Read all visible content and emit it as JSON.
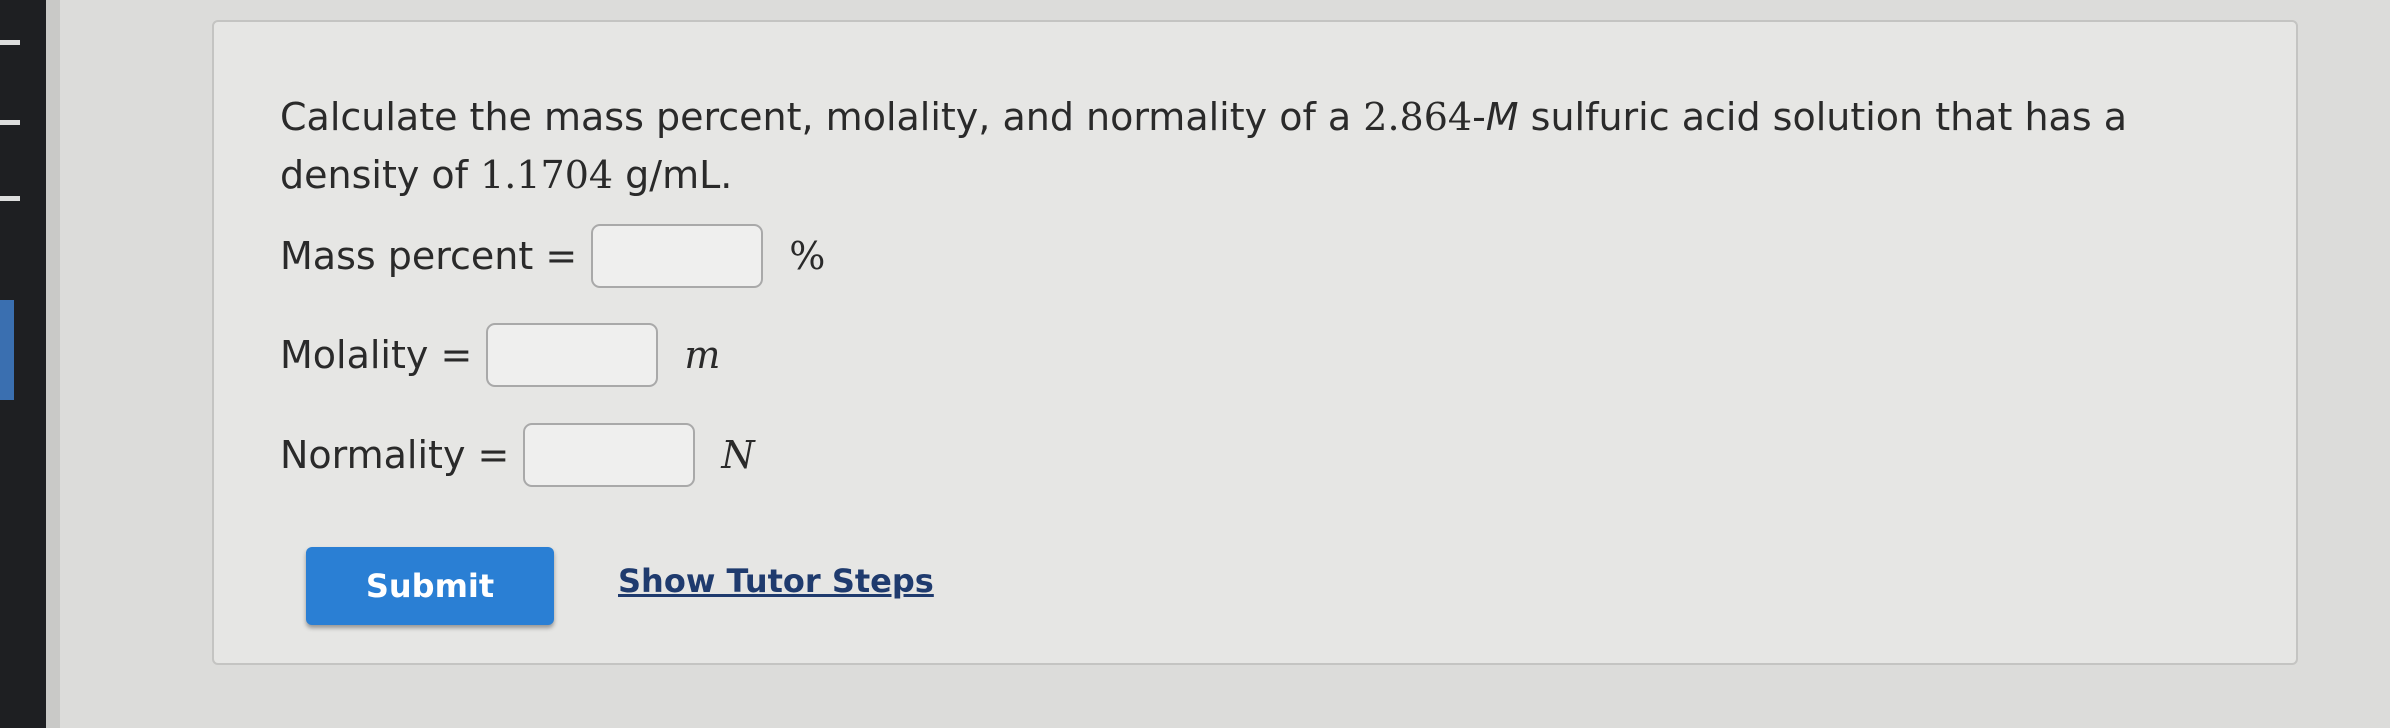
{
  "question": {
    "text_before": "Calculate the mass percent, molality, and normality of a ",
    "molarity_value": "2.864",
    "molarity_dash": "-",
    "molarity_unit": "M",
    "text_middle": " sulfuric acid solution that has a density of ",
    "density_value": "1.1704",
    "text_after": " g/mL."
  },
  "fields": [
    {
      "label": "Mass percent =",
      "value": "",
      "unit": "%"
    },
    {
      "label": "Molality =",
      "value": "",
      "unit": "m"
    },
    {
      "label": "Normality =",
      "value": "",
      "unit": "N"
    }
  ],
  "actions": {
    "submit_label": "Submit",
    "tutor_label": "Show Tutor Steps"
  },
  "colors": {
    "submit_button": "#2a7fd4",
    "link": "#1f3b6e",
    "card_background": "#e6e6e4"
  }
}
